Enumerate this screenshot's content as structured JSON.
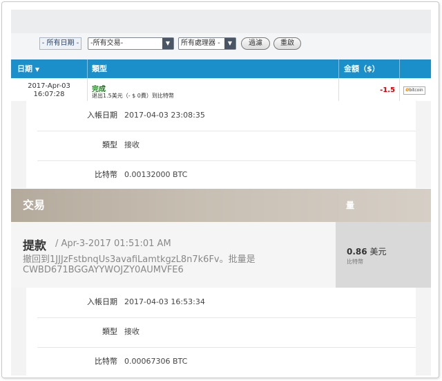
{
  "filters": {
    "date_button": "- 所有日期 -",
    "transaction_select": "-所有交易-",
    "processor_select": "所有處理器 -",
    "filter_button": "過濾",
    "reset_button": "重啟"
  },
  "table": {
    "headers": {
      "date": "日期",
      "type": "類型",
      "amount": "金額（$）"
    },
    "row": {
      "date": "2017-Apr-03",
      "time": "16:07:28",
      "status": "完成",
      "description": "退出1.5美元（- $ 0費）到比特幣",
      "amount": "-1.5",
      "processor_logo": "bitcoin"
    }
  },
  "detail1": {
    "rows": [
      {
        "label": "入帳日期",
        "value": "2017-04-03 23:08:35"
      },
      {
        "label": "類型",
        "value": "接收"
      },
      {
        "label": "比特幣",
        "value": "0.00132000 BTC"
      }
    ]
  },
  "transaction": {
    "header_title": "交易",
    "header_amount": "量",
    "type": "提款",
    "date": "/ Apr-3-2017 01:51:01 AM",
    "line1": "撤回到1JJJzFstbnqUs3avafiLamtkgzL8n7k6Fv。批量是",
    "line2": "CWBD671BGGAYYWOJZY0AUMVFE6",
    "amount": "0.86",
    "amount_unit": "美元",
    "currency": "比特幣"
  },
  "detail2": {
    "rows": [
      {
        "label": "入帳日期",
        "value": "2017-04-03 16:53:34"
      },
      {
        "label": "類型",
        "value": "接收"
      },
      {
        "label": "比特幣",
        "value": "0.00067306 BTC"
      }
    ]
  },
  "colors": {
    "table_header": "#1b8fc9",
    "status_green": "#1a7a1a",
    "amount_red": "#d40000",
    "card_header": "#b4aa9c"
  }
}
